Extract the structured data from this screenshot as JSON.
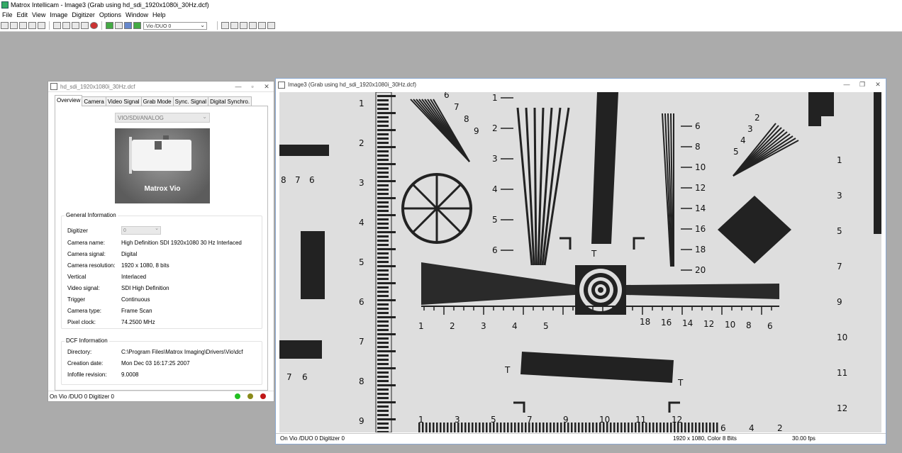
{
  "app": {
    "title": "Matrox Intellicam - Image3 (Grab using hd_sdi_1920x1080i_30Hz.dcf)",
    "menu": [
      "File",
      "Edit",
      "View",
      "Image",
      "Digitizer",
      "Options",
      "Window",
      "Help"
    ],
    "toolbar_combo": "Vio /DUO 0"
  },
  "dcf_window": {
    "title": "hd_sdi_1920x1080i_30Hz.dcf",
    "tabs": [
      "Overview",
      "Camera",
      "Video Signal",
      "Grab Mode",
      "Sync. Signal",
      "Digital Synchro."
    ],
    "board_select": "VIO/SDI/ANALOG",
    "board_name": "Matrox Vio",
    "general_heading": "General Information",
    "digitizer_label": "Digitizer",
    "digitizer_value": "0",
    "general": [
      {
        "k": "Camera name:",
        "v": "High Definition SDI 1920x1080 30 Hz Interlaced"
      },
      {
        "k": "Camera signal:",
        "v": "Digital"
      },
      {
        "k": "Camera resolution:",
        "v": "1920 x 1080, 8 bits"
      },
      {
        "k": "Vertical",
        "v": "Interlaced"
      },
      {
        "k": "Video signal:",
        "v": "SDI High Definition"
      },
      {
        "k": "Trigger",
        "v": "Continuous"
      },
      {
        "k": "Camera type:",
        "v": "Frame Scan"
      },
      {
        "k": "Pixel clock:",
        "v": "74.2500 MHz"
      }
    ],
    "dcf_heading": "DCF Information",
    "dcf": [
      {
        "k": "Directory:",
        "v": "C:\\Program Files\\Matrox Imaging\\Drivers\\Vio\\dcf"
      },
      {
        "k": "Creation date:",
        "v": "Mon Dec 03 16:17:25 2007"
      },
      {
        "k": "Infofile revision:",
        "v": "9.0008"
      }
    ],
    "status": "On Vio /DUO 0 Digitizer 0",
    "leds": [
      "#22c022",
      "#8a8a1a",
      "#c01818"
    ]
  },
  "image_window": {
    "title": "Image3 (Grab using hd_sdi_1920x1080i_30Hz.dcf)",
    "status_left": "On Vio /DUO 0 Digitizer 0",
    "status_res": "1920 x 1080, Color 8 Bits",
    "status_fps": "30.00 fps",
    "chart_labels": {
      "left_scale": [
        "1",
        "2",
        "3",
        "4",
        "5",
        "6",
        "7",
        "8",
        "9"
      ],
      "mid_scale": [
        "1",
        "2",
        "3",
        "4",
        "5",
        "6"
      ],
      "right_scale": [
        "6",
        "8",
        "10",
        "12",
        "14",
        "16",
        "18",
        "20"
      ],
      "far_right": [
        "1",
        "3",
        "5",
        "7",
        "9",
        "10",
        "11",
        "12"
      ],
      "bottom_left": [
        "1",
        "2",
        "3",
        "4",
        "5"
      ],
      "bottom_right": [
        "18",
        "16",
        "14",
        "12",
        "10",
        "8",
        "6"
      ],
      "bottom_row": [
        "1",
        "3",
        "5",
        "7",
        "9",
        "10",
        "11",
        "12"
      ],
      "bottom_row_right": [
        "6",
        "4",
        "2"
      ],
      "fan_left": [
        "6",
        "7",
        "8",
        "9"
      ],
      "fan_right": [
        "2",
        "3",
        "4",
        "5"
      ],
      "left_edge_top": [
        "8",
        "7",
        "6"
      ],
      "left_edge_bottom": [
        "7",
        "6"
      ],
      "tee": "T"
    }
  }
}
